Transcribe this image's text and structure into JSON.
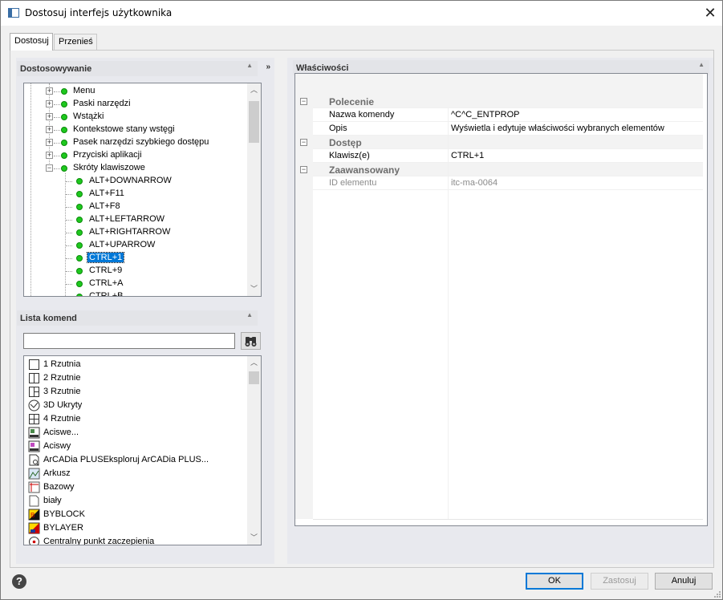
{
  "window": {
    "title": "Dostosuj interfejs użytkownika"
  },
  "tabs": [
    {
      "label": "Dostosuj"
    },
    {
      "label": "Przenieś"
    }
  ],
  "customization": {
    "header": "Dostosowywanie",
    "tree": [
      {
        "label": "Menu",
        "level": 0,
        "expander": "+"
      },
      {
        "label": "Paski narzędzi",
        "level": 0,
        "expander": "+"
      },
      {
        "label": "Wstążki",
        "level": 0,
        "expander": "+"
      },
      {
        "label": "Kontekstowe stany wstęgi",
        "level": 0,
        "expander": "+"
      },
      {
        "label": "Pasek narzędzi szybkiego dostępu",
        "level": 0,
        "expander": "+"
      },
      {
        "label": "Przyciski aplikacji",
        "level": 0,
        "expander": "+"
      },
      {
        "label": "Skróty klawiszowe",
        "level": 0,
        "expander": "−"
      },
      {
        "label": "ALT+DOWNARROW",
        "level": 1
      },
      {
        "label": "ALT+F11",
        "level": 1
      },
      {
        "label": "ALT+F8",
        "level": 1
      },
      {
        "label": "ALT+LEFTARROW",
        "level": 1
      },
      {
        "label": "ALT+RIGHTARROW",
        "level": 1
      },
      {
        "label": "ALT+UPARROW",
        "level": 1
      },
      {
        "label": "CTRL+1",
        "level": 1,
        "selected": true
      },
      {
        "label": "CTRL+9",
        "level": 1
      },
      {
        "label": "CTRL+A",
        "level": 1
      },
      {
        "label": "CTRL+B",
        "level": 1
      }
    ]
  },
  "commands": {
    "header": "Lista komend",
    "search_value": "",
    "search_button_icon": "binoculars-icon",
    "items": [
      {
        "label": "1 Rzutnia",
        "icon": "single-viewport-icon"
      },
      {
        "label": "2 Rzutnie",
        "icon": "two-viewports-icon"
      },
      {
        "label": "3 Rzutnie",
        "icon": "three-viewports-icon"
      },
      {
        "label": "3D Ukryty",
        "icon": "hide-3d-icon"
      },
      {
        "label": "4 Rzutnie",
        "icon": "four-viewports-icon"
      },
      {
        "label": "Aciswe...",
        "icon": "acis-export-icon"
      },
      {
        "label": "Aciswy",
        "icon": "acis-import-icon"
      },
      {
        "label": "ArCADia PLUSEksploruj ArCADia PLUS...",
        "icon": "explore-document-icon"
      },
      {
        "label": "Arkusz",
        "icon": "sheet-icon"
      },
      {
        "label": "Bazowy",
        "icon": "base-icon"
      },
      {
        "label": "biały",
        "icon": "white-color-icon"
      },
      {
        "label": "BYBLOCK",
        "icon": "byblock-icon"
      },
      {
        "label": "BYLAYER",
        "icon": "bylayer-icon"
      },
      {
        "label": "Centralny punkt zaczepienia",
        "icon": "center-snap-icon"
      }
    ]
  },
  "properties": {
    "header": "Właściwości",
    "categories": [
      {
        "name": "Polecenie",
        "rows": [
          {
            "key": "Nazwa komendy",
            "value": "^C^C_ENTPROP"
          },
          {
            "key": "Opis",
            "value": "Wyświetla i edytuje właściwości wybranych elementów"
          }
        ]
      },
      {
        "name": "Dostęp",
        "rows": [
          {
            "key": "Klawisz(e)",
            "value": "CTRL+1"
          }
        ]
      },
      {
        "name": "Zaawansowany",
        "rows": [
          {
            "key": "ID elementu",
            "value": "itc-ma-0064",
            "readonly": true
          }
        ]
      }
    ]
  },
  "footer": {
    "help_icon": "help-icon",
    "help_label": "?",
    "ok": "OK",
    "apply": "Zastosuj",
    "cancel": "Anuluj"
  }
}
